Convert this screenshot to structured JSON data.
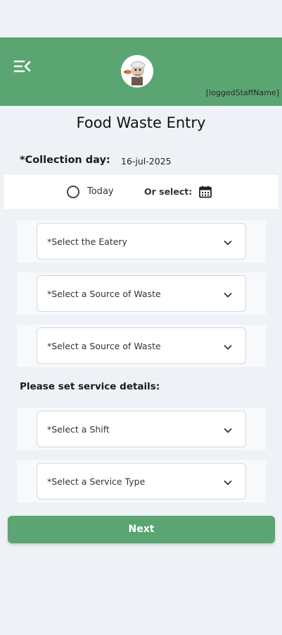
{
  "header": {
    "staff_name": "[loggedStaffName]",
    "menu_icon": "menu-collapse-icon",
    "logo_icon": "chef-mascot-logo"
  },
  "page": {
    "title": "Food Waste Entry"
  },
  "collection": {
    "label": "*Collection day:",
    "value": "16-jul-2025",
    "today_label": "Today",
    "or_select_label": "Or select:",
    "calendar_icon": "calendar-icon"
  },
  "selects": {
    "eatery": "*Select the Eatery",
    "source1": "*Select a Source of Waste",
    "source2": "*Select a Source of Waste",
    "shift": "*Select a Shift",
    "service_type": "*Select a Service Type"
  },
  "service": {
    "label": "Please set service details:"
  },
  "actions": {
    "next": "Next"
  },
  "colors": {
    "brand": "#5aa571",
    "background": "#eef2f6"
  }
}
